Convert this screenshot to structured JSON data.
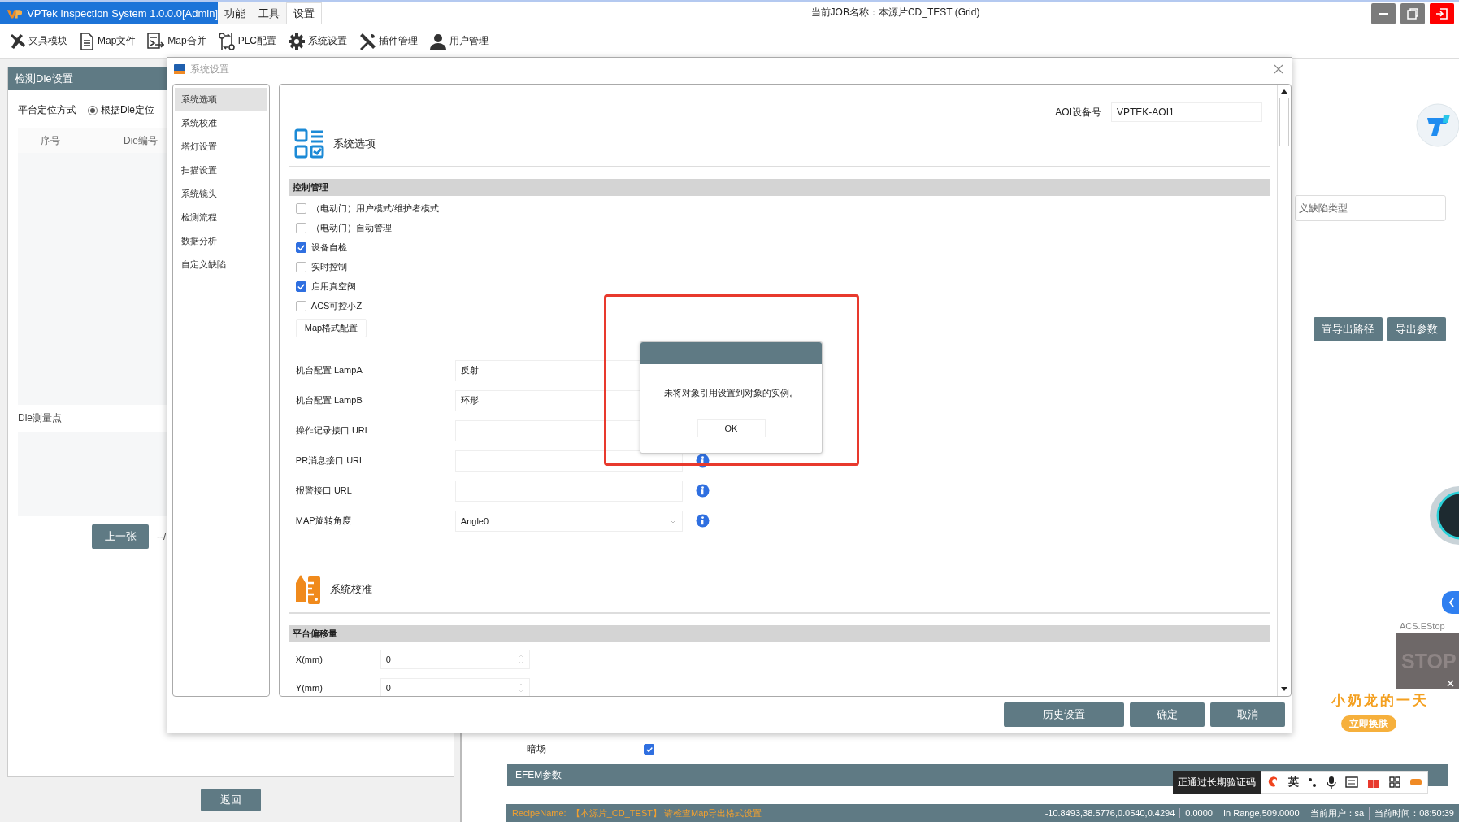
{
  "app": {
    "title": "VPTek Inspection System 1.0.0.0[Admin]",
    "menus": [
      {
        "label": "功能",
        "selected": false
      },
      {
        "label": "工具",
        "selected": false
      },
      {
        "label": "设置",
        "selected": true
      }
    ],
    "job": "当前JOB名称：本源片CD_TEST (Grid)"
  },
  "toolbar": [
    {
      "label": "夹具模块",
      "kind": "clamp"
    },
    {
      "label": "Map文件",
      "kind": "file"
    },
    {
      "label": "Map合并",
      "kind": "merge"
    },
    {
      "label": "PLC配置",
      "kind": "plc"
    },
    {
      "label": "系统设置",
      "kind": "gear"
    },
    {
      "label": "插件管理",
      "kind": "tools"
    },
    {
      "label": "用户管理",
      "kind": "user"
    }
  ],
  "left_panel": {
    "title": "检测Die设置",
    "positioning_label": "平台定位方式",
    "positioning_option": {
      "label": "根据Die定位",
      "selected": true
    },
    "columns": [
      "序号",
      "Die编号"
    ],
    "measure_label": "Die测量点",
    "prev_button": "上一张",
    "page_text": "--/",
    "back_button": "返回"
  },
  "background_panel": {
    "defect_type_field": "义缺陷类型",
    "buttons": [
      "置导出路径",
      "导出参数"
    ],
    "darkfield": {
      "label": "暗场",
      "checked": true
    },
    "efem_title": "EFEM参数"
  },
  "dialog": {
    "title": "系统设置",
    "nav": [
      {
        "label": "系统选项",
        "selected": true
      },
      {
        "label": "系统校准",
        "selected": false
      },
      {
        "label": "塔灯设置",
        "selected": false
      },
      {
        "label": "扫描设置",
        "selected": false
      },
      {
        "label": "系统镜头",
        "selected": false
      },
      {
        "label": "检测流程",
        "selected": false
      },
      {
        "label": "数据分析",
        "selected": false
      },
      {
        "label": "自定义缺陷",
        "selected": false
      }
    ],
    "aoi_label": "AOI设备号",
    "aoi_value": "VPTEK-AOI1",
    "sections": [
      {
        "title": "系统选项",
        "kind": "options",
        "group": "控制管理",
        "checkboxes": [
          {
            "label": "（电动门）用户模式/维护者模式",
            "checked": false
          },
          {
            "label": "（电动门）自动管理",
            "checked": false
          },
          {
            "label": "设备自检",
            "checked": true
          },
          {
            "label": "实时控制",
            "checked": false
          },
          {
            "label": "启用真空阀",
            "checked": true
          },
          {
            "label": "ACS可控小Z",
            "checked": false
          }
        ],
        "button": "Map格式配置",
        "fields": [
          {
            "label": "机台配置 LampA",
            "value": "反射",
            "kind": "text",
            "info": false
          },
          {
            "label": "机台配置 LampB",
            "value": "环形",
            "kind": "text",
            "info": false
          },
          {
            "label": "操作记录接口 URL",
            "kind": "text",
            "info": false
          },
          {
            "label": "PR消息接口 URL",
            "kind": "text",
            "info": true
          },
          {
            "label": "报警接口 URL",
            "kind": "text",
            "info": true
          },
          {
            "label": "MAP旋转角度",
            "value": "Angle0",
            "kind": "select",
            "info": true
          }
        ]
      },
      {
        "title": "系统校准",
        "kind": "calibration",
        "group": "平台偏移量",
        "fields": [
          {
            "label": "X(mm)",
            "value": "0",
            "kind": "spin",
            "info": false
          },
          {
            "label": "Y(mm)",
            "value": "0",
            "kind": "spin",
            "info": false
          }
        ]
      }
    ],
    "footer_buttons": [
      "历史设置",
      "确定",
      "取消"
    ]
  },
  "message_box": {
    "text": "未将对象引用设置到对象的实例。",
    "button": "OK"
  },
  "status_bar": {
    "recipe": "RecipeName:  【本源片_CD_TEST】 请检查Map导出格式设置",
    "items": [
      "-10.8493,38.5776,0.0540,0.4294",
      "0.0000",
      "In Range,509.0000",
      "当前用户：sa",
      "当前时间：08:50:39"
    ]
  },
  "overlays": {
    "estop_label": "ACS.EStop",
    "estop_sign": "STOP",
    "ime_notice": "正通过长期验证码",
    "ime_lang": "英",
    "sticker_title": "小奶龙的一天",
    "sticker_button": "立即换肤"
  }
}
